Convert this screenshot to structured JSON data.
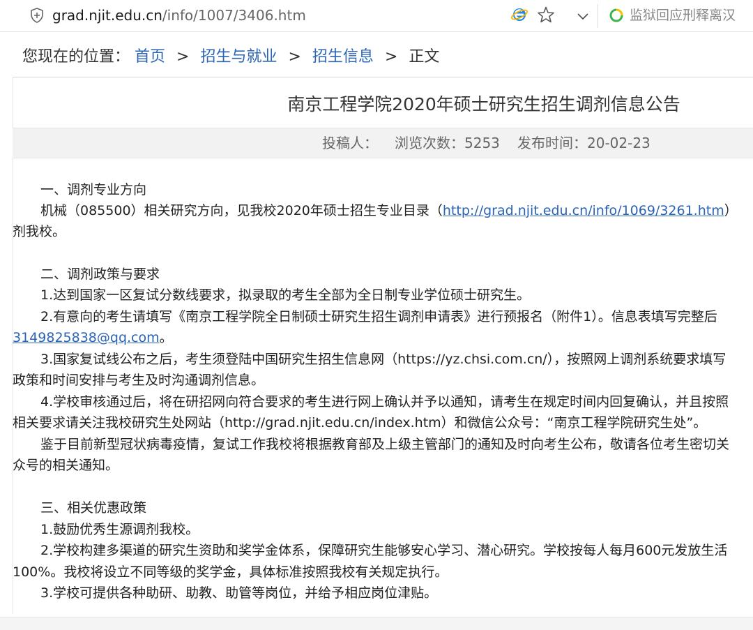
{
  "browser": {
    "url_host": "grad.njit.edu.cn",
    "url_path": "/info/1007/3406.htm",
    "hot_search": "监狱回应刑释离汉"
  },
  "breadcrumb": {
    "prefix": "您现在的位置：",
    "items": [
      "首页",
      "招生与就业",
      "招生信息"
    ],
    "current": "正文",
    "separator": ">"
  },
  "article": {
    "title": "南京工程学院2020年硕士研究生招生调剂信息公告",
    "meta": {
      "author": "投稿人：",
      "views": "浏览次数：5253",
      "date": "发布时间：20-02-23"
    },
    "lines": {
      "s1_head": "一、调剂专业方向",
      "s1_l1_a": "机械（085500）相关研究方向，见我校2020年硕士招生专业目录（",
      "s1_l1_link": "http://grad.njit.edu.cn/info/1069/3261.htm",
      "s1_l1_b": "）",
      "s1_l2": "剂我校。",
      "s2_head": "二、调剂政策与要求",
      "s2_p1": "1.达到国家一区复试分数线要求，拟录取的考生全部为全日制专业学位硕士研究生。",
      "s2_p2": "2.有意向的考生请填写《南京工程学院全日制硕士研究生招生调剂申请表》进行预报名（附件1）。信息表填写完整后",
      "s2_p2_email": "3149825838@qq.com",
      "s2_p2_end": "。",
      "s2_p3": "3.国家复试线公布之后，考生须登陆中国研究生招生信息网（https://yz.chsi.com.cn/），按照网上调剂系统要求填写",
      "s2_p3_l2": "政策和时间安排与考生及时沟通调剂信息。",
      "s2_p4": "4.学校审核通过后，将在研招网向符合要求的考生进行网上确认并予以通知，请考生在规定时间内回复确认，并且按照",
      "s2_p4_l2": "相关要求请关注我校研究生处网站（http://grad.njit.edu.cn/index.htm）和微信公众号：“南京工程学院研究生处”。",
      "s2_p5": "鉴于目前新型冠状病毒疫情，复试工作我校将根据教育部及上级主管部门的通知及时向考生公布，敬请各位考生密切关",
      "s2_p5_l2": "众号的相关通知。",
      "s3_head": "三、相关优惠政策",
      "s3_p1": "1.鼓励优秀生源调剂我校。",
      "s3_p2": "2.学校构建多渠道的研究生资助和奖学金体系，保障研究生能够安心学习、潜心研究。学校按每人每月600元发放生活",
      "s3_p2_l2": "100%。我校将设立不同等级的奖学金，具体标准按照我校有关规定执行。",
      "s3_p3": "3.学校可提供各种助研、助教、助管等岗位，并给予相应岗位津贴。"
    }
  }
}
